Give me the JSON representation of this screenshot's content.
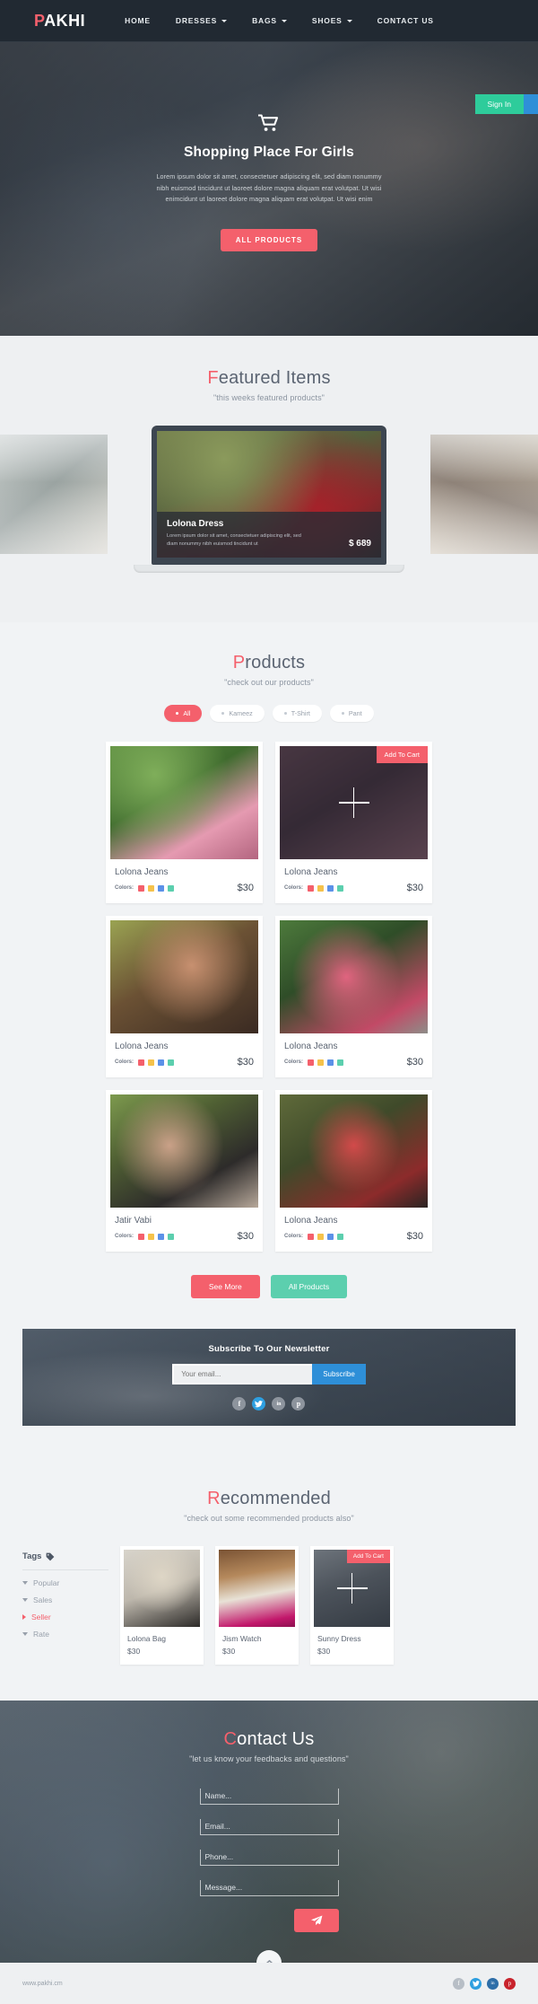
{
  "brand": {
    "cap": "P",
    "rest": "AKHI"
  },
  "nav": {
    "items": [
      {
        "label": "HOME",
        "caret": false
      },
      {
        "label": "DRESSES",
        "caret": true
      },
      {
        "label": "BAGS",
        "caret": true
      },
      {
        "label": "SHOES",
        "caret": true
      },
      {
        "label": "CONTACT US",
        "caret": false
      }
    ]
  },
  "auth": {
    "signin": "Sign In",
    "signup": ""
  },
  "hero": {
    "icon": "shopping-cart-icon",
    "title": "Shopping Place For Girls",
    "text": "Lorem ipsum dolor sit amet, consectetuer adipiscing elit, sed diam nonummy nibh euismod tincidunt ut laoreet dolore magna aliquam erat volutpat. Ut wisi enimcidunt ut laoreet dolore magna aliquam erat volutpat. Ut wisi enim",
    "button": "ALL PRODUCTS"
  },
  "featured": {
    "title_cap": "F",
    "title_rest": "eatured Items",
    "subtitle": "\"this weeks featured products\"",
    "slide": {
      "title": "Lolona Dress",
      "desc": "Lorem ipsum dolor sit amet, consectetuer adipiscing elit, sed diam nonummy nibh euismod tincidunt ut",
      "price": "$ 689"
    }
  },
  "products": {
    "title_cap": "P",
    "title_rest": "roducts",
    "subtitle": "\"check out our products\"",
    "filters": [
      {
        "label": "All",
        "active": true
      },
      {
        "label": "Kameez",
        "active": false
      },
      {
        "label": "T-Shirt",
        "active": false
      },
      {
        "label": "Pant",
        "active": false
      }
    ],
    "colors_label": "Colors:",
    "swatches": [
      "#f4606c",
      "#f5c24b",
      "#5b91e8",
      "#5ccfae"
    ],
    "add_to_cart": "Add To Cart",
    "items": [
      {
        "name": "Lolona Jeans",
        "price": "$30",
        "hover": false
      },
      {
        "name": "Lolona Jeans",
        "price": "$30",
        "hover": true
      },
      {
        "name": "Lolona Jeans",
        "price": "$30",
        "hover": false
      },
      {
        "name": "Lolona Jeans",
        "price": "$30",
        "hover": false
      },
      {
        "name": "Jatir Vabi",
        "price": "$30",
        "hover": false
      },
      {
        "name": "Lolona Jeans",
        "price": "$30",
        "hover": false
      }
    ],
    "see_more": "See More",
    "all_products": "All Products"
  },
  "newsletter": {
    "title": "Subscribe To Our Newsletter",
    "placeholder": "Your email...",
    "button": "Subscribe",
    "socials": [
      {
        "name": "facebook-icon",
        "glyph": "f"
      },
      {
        "name": "twitter-icon",
        "glyph": "t"
      },
      {
        "name": "linkedin-icon",
        "glyph": "in"
      },
      {
        "name": "pinterest-icon",
        "glyph": "p"
      }
    ]
  },
  "recommended": {
    "title_cap": "R",
    "title_rest": "ecommended",
    "subtitle": "\"check out some recommended products also\"",
    "tags_heading": "Tags",
    "tags_icon": "tag-icon",
    "tags": [
      {
        "label": "Popular",
        "active": false
      },
      {
        "label": "Sales",
        "active": false
      },
      {
        "label": "Seller",
        "active": true
      },
      {
        "label": "Rate",
        "active": false
      }
    ],
    "add_to_cart": "Add To Cart",
    "items": [
      {
        "name": "Lolona Bag",
        "price": "$30",
        "hover": false
      },
      {
        "name": "Jism Watch",
        "price": "$30",
        "hover": false
      },
      {
        "name": "Sunny Dress",
        "price": "$30",
        "hover": true
      }
    ]
  },
  "contact": {
    "title_cap": "C",
    "title_rest": "ontact Us",
    "subtitle": "\"let us know your feedbacks and questions\"",
    "fields": [
      {
        "name": "name-field",
        "placeholder": "Name..."
      },
      {
        "name": "email-field",
        "placeholder": "Email..."
      },
      {
        "name": "phone-field",
        "placeholder": "Phone..."
      },
      {
        "name": "message-field",
        "placeholder": "Message..."
      }
    ],
    "send_icon": "send-paper-plane-icon"
  },
  "footer": {
    "text": "www.pakhi.cm",
    "scroll_top_icon": "chevron-up-icon",
    "socials": [
      {
        "name": "facebook-icon",
        "glyph": "f"
      },
      {
        "name": "twitter-icon",
        "glyph": "t"
      },
      {
        "name": "linkedin-icon",
        "glyph": "in"
      },
      {
        "name": "pinterest-icon",
        "glyph": "p"
      }
    ]
  },
  "theme": {
    "pink": "#f4606c",
    "green": "#2ecc9b",
    "blue": "#2e8fd8",
    "dark": "#212932"
  }
}
